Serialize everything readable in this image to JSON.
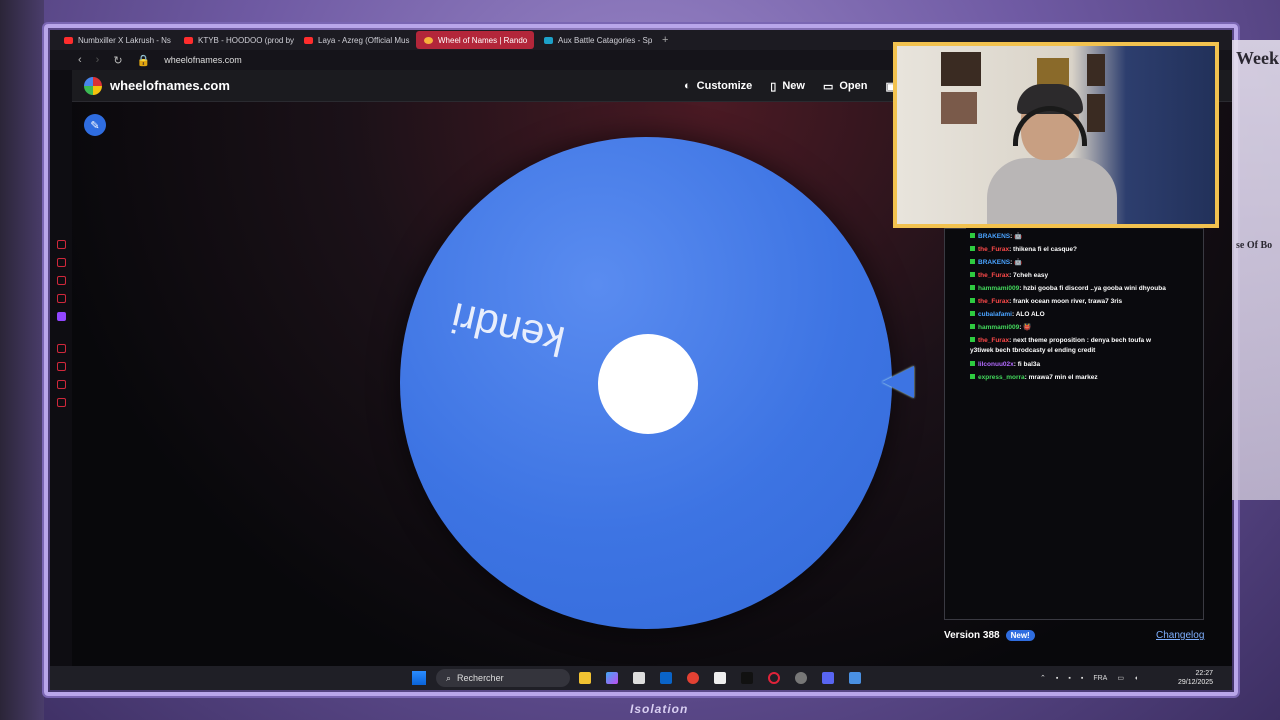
{
  "browser": {
    "tabs": [
      {
        "label": "Numbxiller X Lakrush - Ns",
        "active": false
      },
      {
        "label": "KTYB - HOODOO (prod by",
        "active": false
      },
      {
        "label": "Laya - Azreg (Official Mus",
        "active": false
      },
      {
        "label": "Wheel of Names | Rando",
        "active": true
      },
      {
        "label": "Aux Battle Catagories - Sp",
        "active": false
      }
    ],
    "new_tab": "+",
    "url": "wheelofnames.com"
  },
  "app": {
    "site_name": "wheelofnames.com",
    "header_buttons": {
      "customize": "Customize",
      "new": "New",
      "open": "Open"
    },
    "wheel": {
      "entry_label": "kendri",
      "color": "#3d74e3"
    },
    "version": "Version 388",
    "new_badge": "New!",
    "changelog": "Changelog"
  },
  "chat": {
    "messages": [
      {
        "user": "BRAKENS",
        "text": ": 🤖",
        "color": "#4aa3ff"
      },
      {
        "user": "the_Furax",
        "text": ": thikena fi el casque?",
        "color": "#ff4a4a"
      },
      {
        "user": "BRAKENS",
        "text": ": 🤖",
        "color": "#4aa3ff"
      },
      {
        "user": "the_Furax",
        "text": ": 7cheh easy",
        "color": "#ff4a4a"
      },
      {
        "user": "hammami009",
        "text": ": hzbi gooba fi discord ..ya gooba wini dhyouba",
        "color": "#43d85c"
      },
      {
        "user": "the_Furax",
        "text": ": frank ocean moon river, trawa7 3ris",
        "color": "#ff4a4a"
      },
      {
        "user": "cubalafami",
        "text": ": ALO ALO",
        "color": "#4aa3ff"
      },
      {
        "user": "hammami009",
        "text": ": 👹",
        "color": "#43d85c"
      },
      {
        "user": "the_Furax",
        "text": ": next theme proposition : denya bech toufa w y3tiwek bech tbrodcasty el ending credit",
        "color": "#ff4a4a"
      },
      {
        "user": "lilconuu02x",
        "text": ": fi bal3a",
        "color": "#b36bff"
      },
      {
        "user": "express_morra",
        "text": ": mrawa7 min el markez",
        "color": "#43d85c"
      }
    ]
  },
  "taskbar": {
    "search_placeholder": "Rechercher",
    "lang": "FRA",
    "time": "22:27",
    "date": "29/12/2025"
  },
  "overlay": {
    "logo_text": "Isolation",
    "poster_texts": [
      "Week",
      "se Of Bo"
    ]
  }
}
